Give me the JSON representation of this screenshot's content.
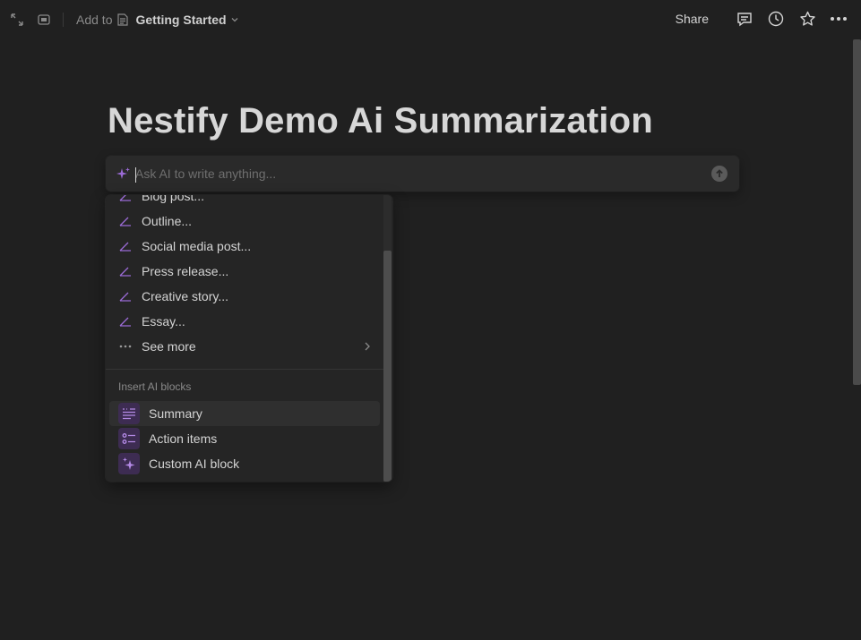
{
  "topbar": {
    "add_to_label": "Add to",
    "breadcrumb_page": "Getting Started",
    "share_label": "Share"
  },
  "page": {
    "title": "Nestify Demo Ai Summarization"
  },
  "ai_prompt": {
    "placeholder": "Ask AI to write anything..."
  },
  "menu": {
    "draft_items": [
      {
        "label": "Blog post..."
      },
      {
        "label": "Outline..."
      },
      {
        "label": "Social media post..."
      },
      {
        "label": "Press release..."
      },
      {
        "label": "Creative story..."
      },
      {
        "label": "Essay..."
      }
    ],
    "see_more_label": "See more",
    "section_title": "Insert AI blocks",
    "blocks": [
      {
        "label": "Summary",
        "icon": "summary-icon"
      },
      {
        "label": "Action items",
        "icon": "checklist-icon"
      },
      {
        "label": "Custom AI block",
        "icon": "sparkle-icon"
      }
    ]
  },
  "colors": {
    "accent": "#9b6bd6",
    "background": "#202020",
    "menu_background": "#252525"
  }
}
